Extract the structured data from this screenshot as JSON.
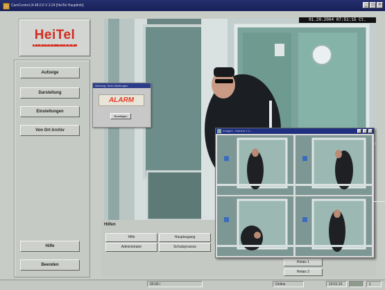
{
  "window": {
    "title": "CamControl (4.48.0.0  V 3.24 [HeiTel Hauptinfo]",
    "controls": [
      "_",
      "□",
      "×"
    ]
  },
  "logo": {
    "text": "HeiTel",
    "tagline": "DIGITAL VIDEO"
  },
  "sidebar": {
    "items": [
      {
        "label": "Aufzeige"
      },
      {
        "label": "Darstellung"
      },
      {
        "label": "Einstellungen"
      },
      {
        "label": "Von Ort Archiv"
      }
    ],
    "bottom": [
      {
        "label": "Hilfe"
      },
      {
        "label": "Beenden"
      }
    ]
  },
  "video": {
    "timestamp": "01.20.2004  07:51:15 Ct."
  },
  "alarm_popup": {
    "title": "Meldung: Sicht Meldungen",
    "message": "ALARM",
    "ok_label": "Bestätigen"
  },
  "quad_window": {
    "title": "Anlagen - Kamera 1-4 ...",
    "cameras": [
      {
        "label": "1"
      },
      {
        "label": "2"
      },
      {
        "label": "3"
      },
      {
        "label": "4"
      }
    ]
  },
  "hilfen": {
    "title": "Hilfen",
    "buttons": [
      {
        "label": "Hilfe"
      },
      {
        "label": "Hauptzugang"
      },
      {
        "label": "Administrator"
      },
      {
        "label": "Schutzprozess"
      }
    ]
  },
  "function_buttons": [
    {
      "label": "Relais 1"
    },
    {
      "label": "Relais 2"
    }
  ],
  "statusbar": {
    "code": "00:00 /",
    "status": "Online",
    "time": "10:51:15",
    "counter": "1"
  }
}
